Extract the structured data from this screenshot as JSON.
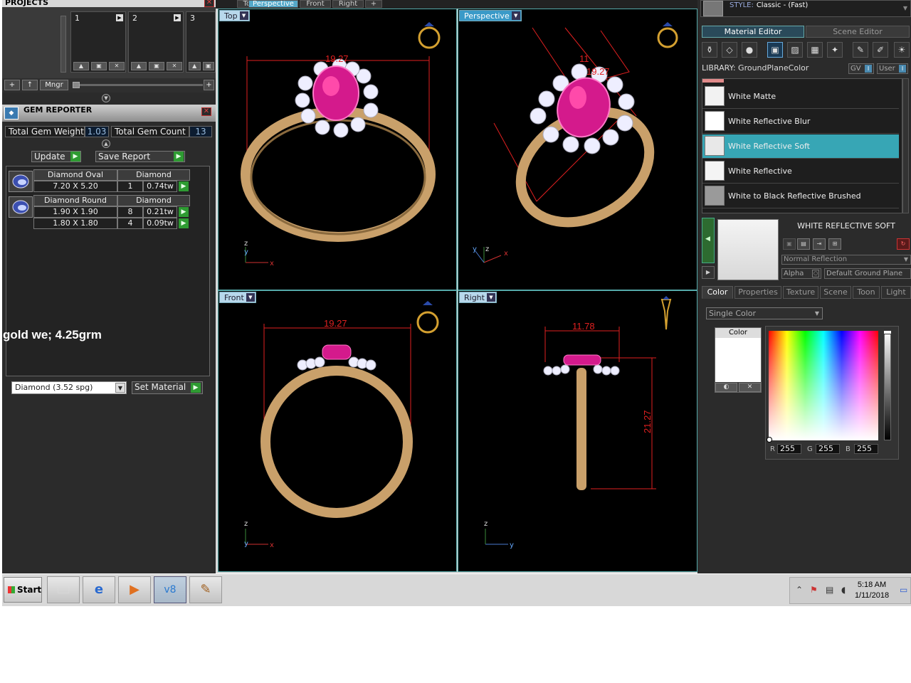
{
  "projects": {
    "title": "PROJECTS",
    "slots": [
      "1",
      "2",
      "3"
    ],
    "mngr": "Mngr",
    "add": "+",
    "up": "↑"
  },
  "gem_reporter": {
    "title": "GEM REPORTER",
    "total_weight_label": "Total Gem Weight",
    "total_weight_value": "1.03",
    "total_count_label": "Total Gem Count",
    "total_count_value": "13",
    "update_label": "Update",
    "save_report_label": "Save Report",
    "gems": [
      {
        "name": "Diamond Oval",
        "material": "Diamond",
        "rows": [
          {
            "size": "7.20 X 5.20",
            "count": "1",
            "weight": "0.74tw"
          }
        ]
      },
      {
        "name": "Diamond Round",
        "material": "Diamond",
        "rows": [
          {
            "size": "1.90 X 1.90",
            "count": "8",
            "weight": "0.21tw"
          },
          {
            "size": "1.80 X 1.80",
            "count": "4",
            "weight": "0.09tw"
          }
        ]
      }
    ],
    "annotation": "gold we; 4.25grm",
    "material_select": "Diamond    (3.52 spg)",
    "set_material_label": "Set Material"
  },
  "viewport_tabs": [
    "Top",
    "Perspective",
    "Front",
    "Right",
    "+"
  ],
  "viewports": {
    "top": {
      "label": "Top",
      "dim_width": "19.27"
    },
    "perspective": {
      "label": "Perspective",
      "dim_a": "11",
      "dim_b": "19.27"
    },
    "front": {
      "label": "Front",
      "dim_width": "19.27"
    },
    "right": {
      "label": "Right",
      "dim_width": "11.78",
      "dim_height": "21.27"
    }
  },
  "axes": {
    "x": "x",
    "y": "y",
    "z": "z"
  },
  "right_panel": {
    "style_label": "STYLE:",
    "style_value": "Classic - (Fast)",
    "tabs": [
      "Material Editor",
      "Scene Editor"
    ],
    "library_label": "LIBRARY: GroundPlaneColor",
    "gv": "GV",
    "user": "User",
    "materials": [
      {
        "name": "White Matte",
        "swatch": "#f2f2f2"
      },
      {
        "name": "White Reflective Blur",
        "swatch": "#ffffff"
      },
      {
        "name": "White Reflective Soft",
        "swatch": "#e8e8e8",
        "selected": true
      },
      {
        "name": "White Reflective",
        "swatch": "#f4f4f4"
      },
      {
        "name": "White to Black Reflective Brushed",
        "swatch": "#9a9a9a"
      }
    ],
    "selected_name": "WHITE REFLECTIVE SOFT",
    "reflection": "Normal Reflection",
    "alpha": "Alpha",
    "ground_plane": "Default Ground Plane",
    "prop_tabs": [
      "Color",
      "Properties",
      "Texture",
      "Scene",
      "Toon",
      "Light"
    ],
    "color_mode": "Single Color",
    "color_title": "Color",
    "rgb": {
      "r_label": "R",
      "g_label": "G",
      "b_label": "B",
      "r": "255",
      "g": "255",
      "b": "255"
    },
    "accent": "#37a6b5"
  },
  "taskbar": {
    "start": "Start",
    "time": "5:18 AM",
    "date": "1/11/2018"
  }
}
